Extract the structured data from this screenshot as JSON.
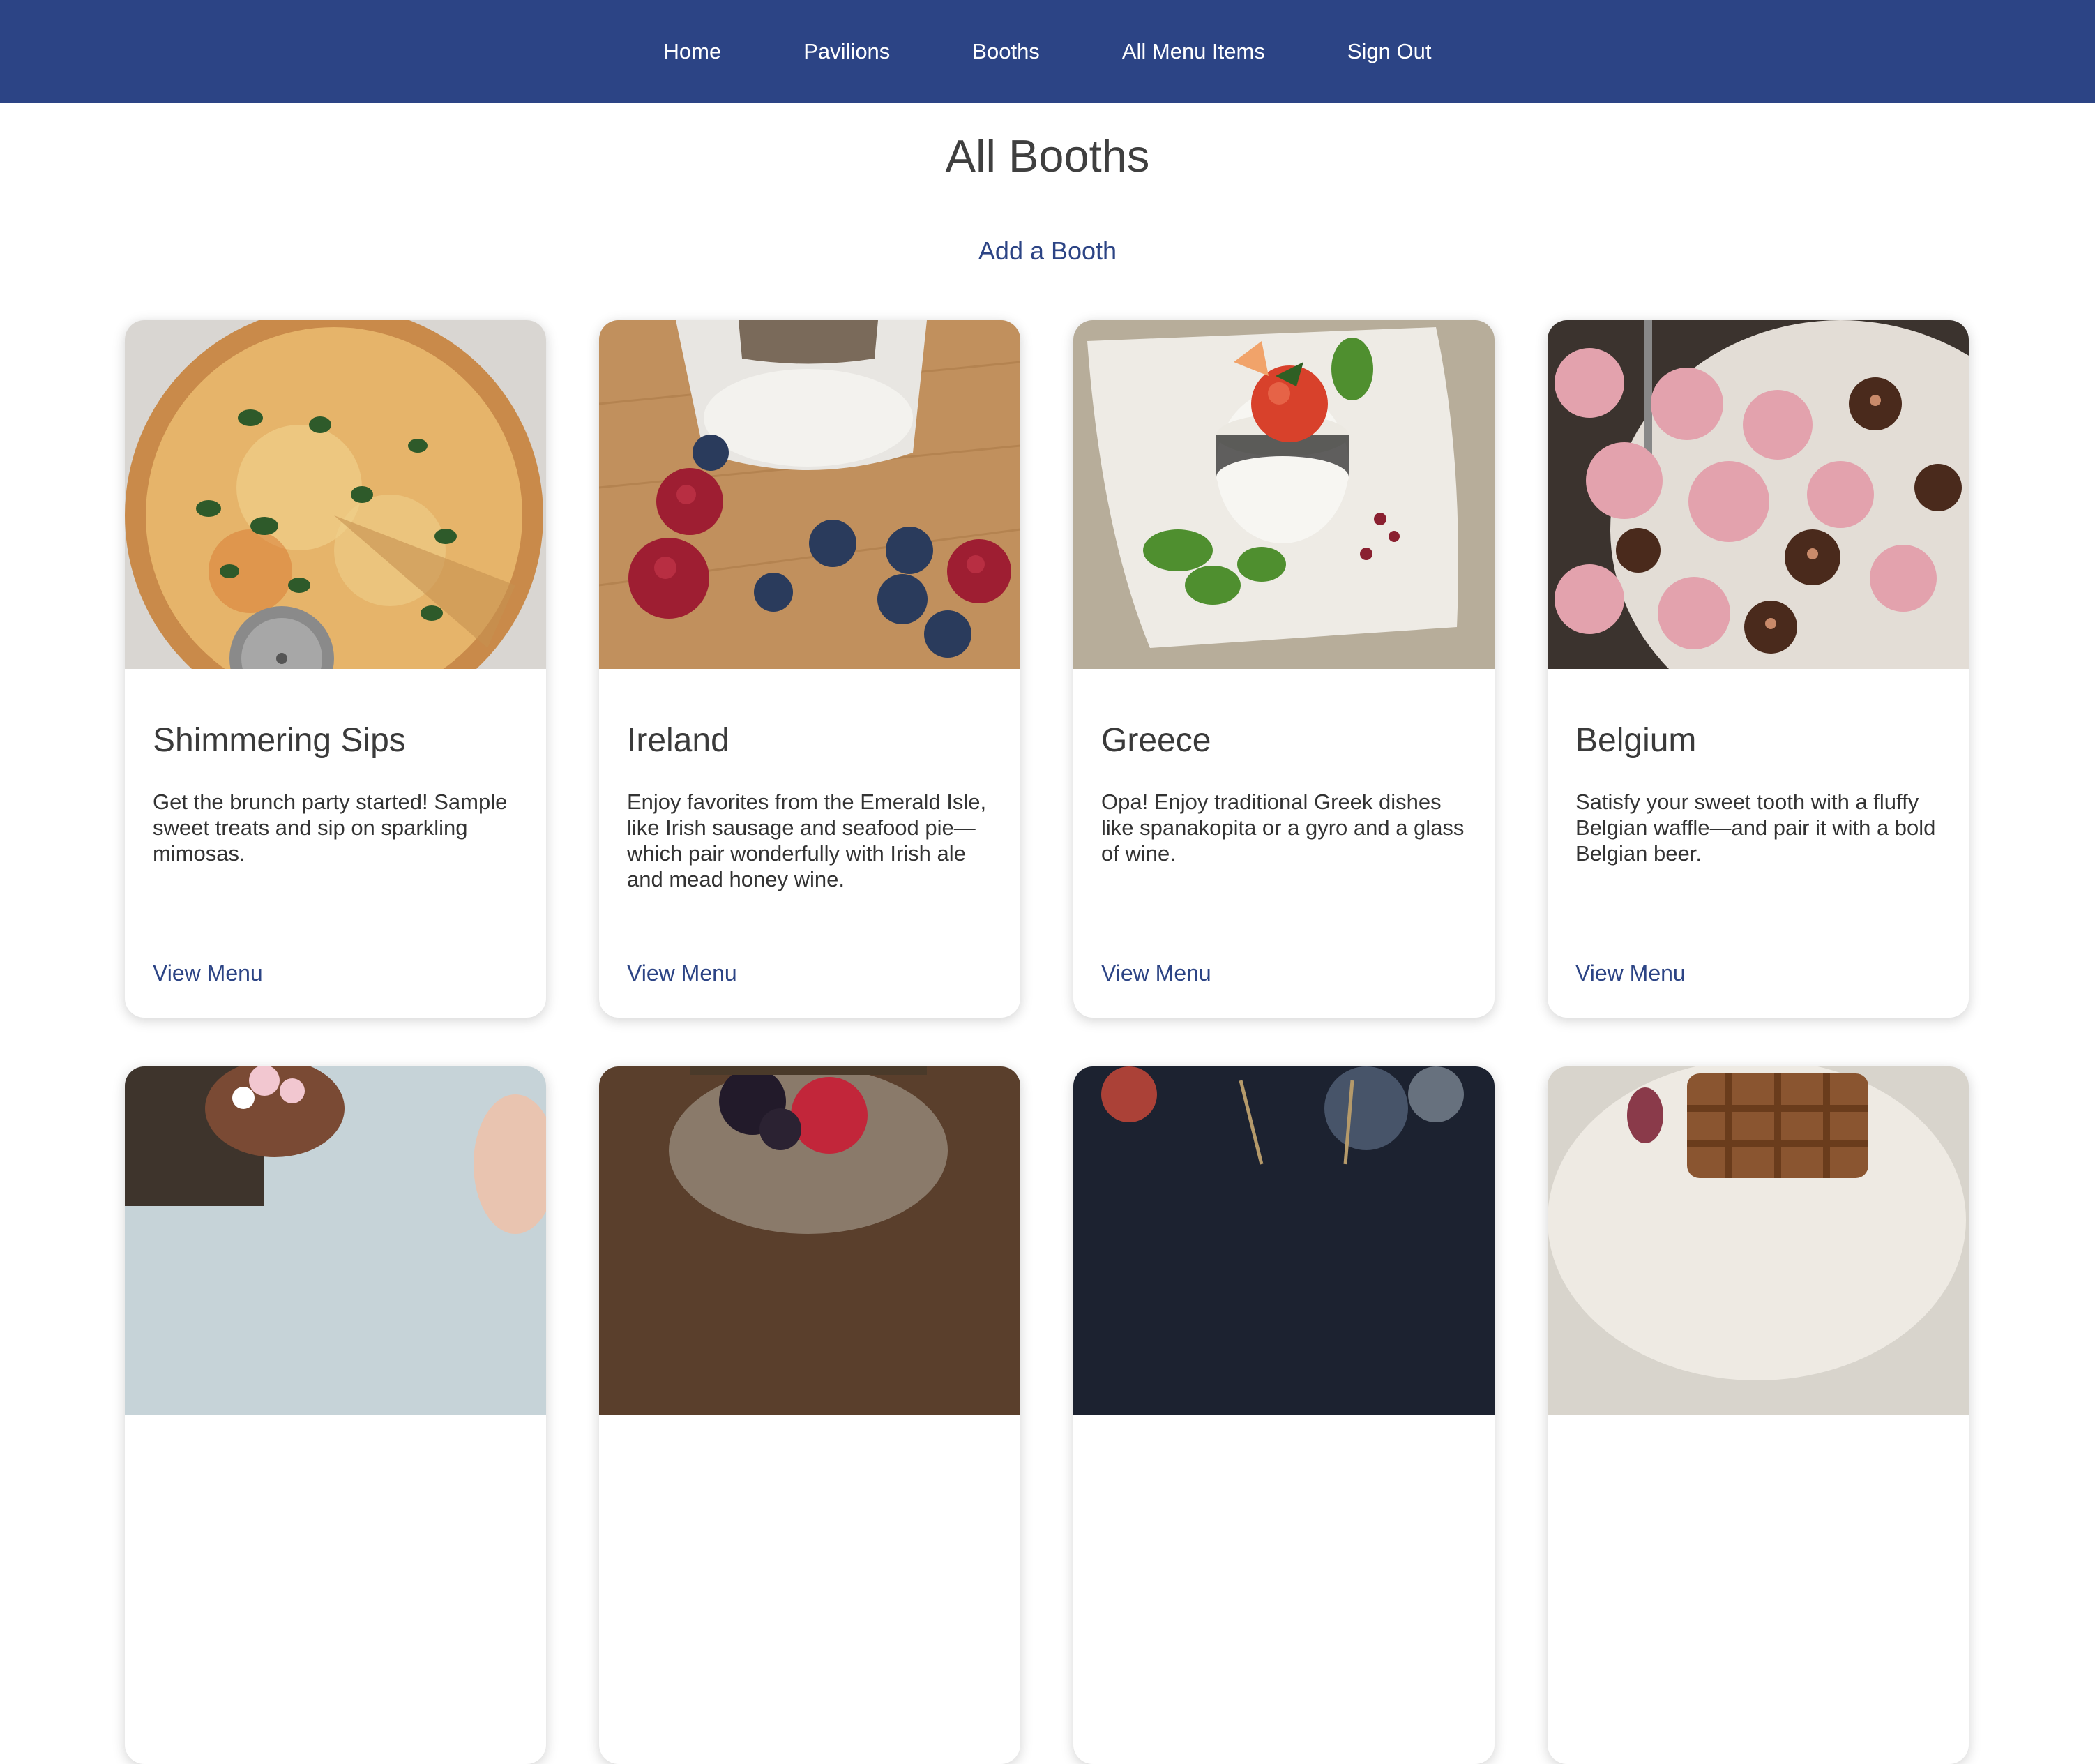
{
  "nav": {
    "items": [
      {
        "label": "Home"
      },
      {
        "label": "Pavilions"
      },
      {
        "label": "Booths"
      },
      {
        "label": "All Menu Items"
      },
      {
        "label": "Sign Out"
      }
    ]
  },
  "page": {
    "title": "All Booths",
    "add_link": "Add a Booth"
  },
  "colors": {
    "nav_bg": "#2c4485",
    "link": "#2c4485",
    "title": "#3f3f3f"
  },
  "booths": [
    {
      "name": "Shimmering Sips",
      "description": "Get the brunch party started! Sample sweet treats and sip on sparkling mimosas.",
      "link": "View Menu",
      "image": "pizza-photo"
    },
    {
      "name": "Ireland",
      "description": "Enjoy favorites from the Emerald Isle, like Irish sausage and seafood pie—which pair wonderfully with Irish ale and mead honey wine.",
      "link": "View Menu",
      "image": "berries-yogurt-photo"
    },
    {
      "name": "Greece",
      "description": "Opa! Enjoy traditional Greek dishes like spanakopita or a gyro and a glass of wine.",
      "link": "View Menu",
      "image": "tomato-rice-plate-photo"
    },
    {
      "name": "Belgium",
      "description": "Satisfy your sweet tooth with a fluffy Belgian waffle—and pair it with a bold Belgian beer.",
      "link": "View Menu",
      "image": "pink-chocolate-cupcakes-photo"
    },
    {
      "image": "dessert-cup-photo"
    },
    {
      "image": "berry-jar-photo"
    },
    {
      "image": "skewer-bokeh-photo"
    },
    {
      "image": "waffle-plate-photo"
    }
  ]
}
